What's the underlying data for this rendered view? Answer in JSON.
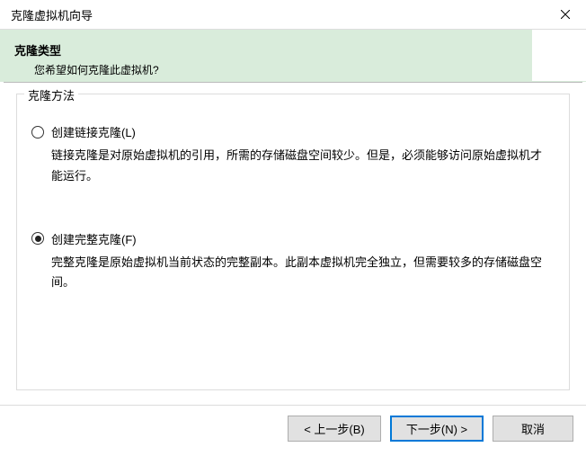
{
  "window": {
    "title": "克隆虚拟机向导"
  },
  "header": {
    "title": "克隆类型",
    "subtitle": "您希望如何克隆此虚拟机?"
  },
  "groupbox": {
    "label": "克隆方法"
  },
  "options": {
    "linked": {
      "label": "创建链接克隆(L)",
      "desc": "链接克隆是对原始虚拟机的引用，所需的存储磁盘空间较少。但是，必须能够访问原始虚拟机才能运行。",
      "selected": false
    },
    "full": {
      "label": "创建完整克隆(F)",
      "desc": "完整克隆是原始虚拟机当前状态的完整副本。此副本虚拟机完全独立，但需要较多的存储磁盘空间。",
      "selected": true
    }
  },
  "buttons": {
    "back": "< 上一步(B)",
    "next": "下一步(N) >",
    "cancel": "取消"
  }
}
